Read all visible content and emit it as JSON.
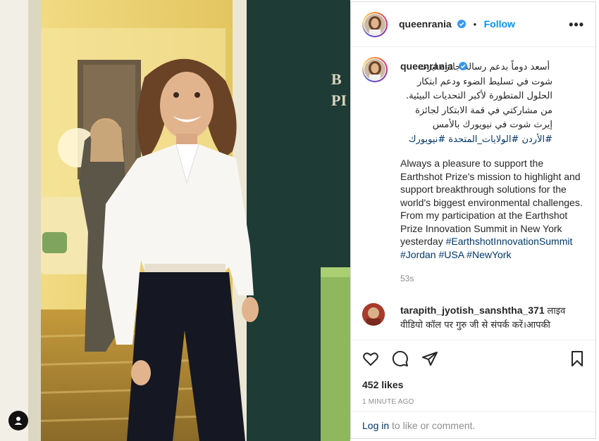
{
  "post": {
    "username": "queenrania",
    "follow_label": "Follow",
    "dot": "•",
    "more_label": "•••"
  },
  "caption": {
    "username": "queenrania",
    "arabic_text": "أسعد دوماً بدعم رسالة جائزة ايرث شوت في تسليط الضوء ودعم ابتكار الحلول المتطورة لأكبر التحديات البيئية. من مشاركتي في قمة الابتكار لجائزة إيرث شوت في نيويورك بالأمس",
    "arabic_hashtags": "#الأردن #الولايات_المتحدة #نيويورك",
    "english_text": "Always a pleasure to support the Earthshot Prize's mission to highlight and support breakthrough solutions for the world's biggest environmental challenges. From my participation at the Earthshot Prize Innovation Summit in New York yesterday",
    "english_hashtags": "#EarthshotInnovationSummit #Jordan #USA #NewYork",
    "time": "53s"
  },
  "comment": {
    "username": "tarapith_jyotish_sanshtha_371",
    "text": "लाइव वीडियो कॉल पर गुरु जी से संपर्क करें।आपकी"
  },
  "stats": {
    "likes": "452 likes",
    "ago": "1 MINUTE AGO"
  },
  "login": {
    "link": "Log in",
    "rest": "to like or comment."
  },
  "colors": {
    "accent": "#0095f6",
    "hashtag": "#00376b",
    "muted": "#8e8e8e"
  },
  "icons": {
    "verified": "verified-badge-icon",
    "like": "heart-icon",
    "comment": "comment-icon",
    "share": "paper-plane-icon",
    "save": "bookmark-icon",
    "user": "user-tag-icon"
  }
}
